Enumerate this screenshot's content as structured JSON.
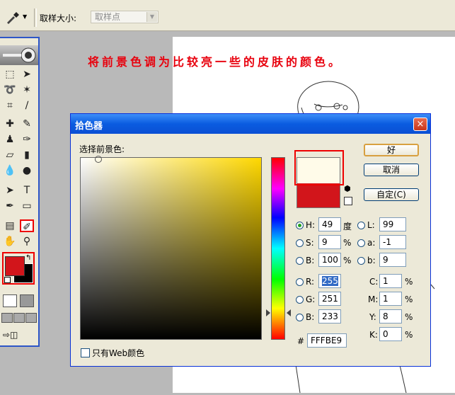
{
  "options_bar": {
    "sample_size_label": "取样大小:",
    "sample_size_value": "取样点"
  },
  "instruction": "将前景色调为比较亮一些的皮肤的颜色。",
  "dialog": {
    "title": "拾色器",
    "close": "×",
    "pick_label": "选择前景色:",
    "ok": "好",
    "cancel": "取消",
    "custom": "自定(C)",
    "web_only": "只有Web颜色",
    "new_color": "#FFFBE9",
    "old_color": "#D2151B",
    "fields": {
      "H": {
        "label": "H:",
        "value": "49",
        "unit": "度"
      },
      "S": {
        "label": "S:",
        "value": "9",
        "unit": "%"
      },
      "B": {
        "label": "B:",
        "value": "100",
        "unit": "%"
      },
      "R": {
        "label": "R:",
        "value": "255"
      },
      "G": {
        "label": "G:",
        "value": "251"
      },
      "Bl": {
        "label": "B:",
        "value": "233"
      },
      "L": {
        "label": "L:",
        "value": "99"
      },
      "a": {
        "label": "a:",
        "value": "-1"
      },
      "b": {
        "label": "b:",
        "value": "9"
      },
      "C": {
        "label": "C:",
        "value": "1",
        "unit": "%"
      },
      "M": {
        "label": "M:",
        "value": "1",
        "unit": "%"
      },
      "Y": {
        "label": "Y:",
        "value": "8",
        "unit": "%"
      },
      "K": {
        "label": "K:",
        "value": "0",
        "unit": "%"
      },
      "hex": {
        "label": "#",
        "value": "FFFBE9"
      }
    }
  },
  "toolbox": {
    "foreground_color": "#D2151B",
    "background_color": "#000000",
    "tools": [
      "marquee-icon",
      "move-icon",
      "lasso-icon",
      "magic-wand-icon",
      "crop-icon",
      "slice-icon",
      "healing-icon",
      "brush-icon",
      "stamp-icon",
      "history-brush-icon",
      "eraser-icon",
      "gradient-icon",
      "blur-icon",
      "dodge-icon",
      "path-select-icon",
      "type-icon",
      "pen-icon",
      "shape-icon",
      "notes-icon",
      "eyedropper-icon",
      "hand-icon",
      "zoom-icon"
    ]
  }
}
